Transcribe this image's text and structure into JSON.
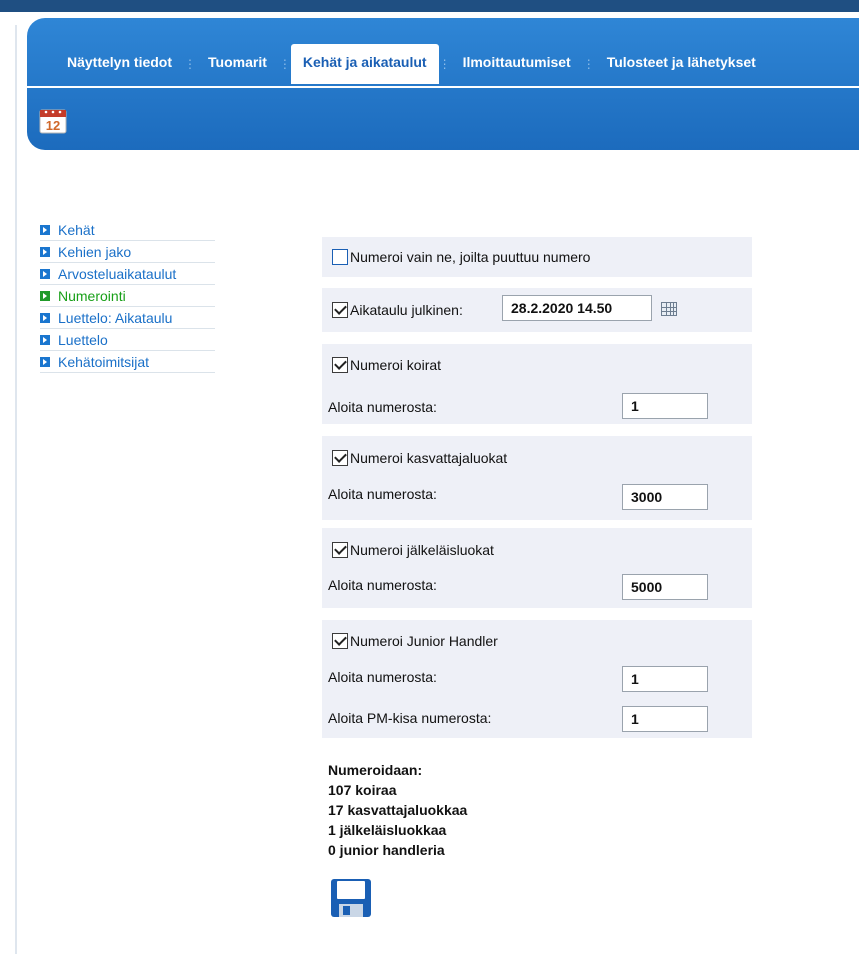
{
  "nav": {
    "tabs": [
      {
        "label": "Näyttelyn tiedot"
      },
      {
        "label": "Tuomarit"
      },
      {
        "label": "Kehät ja aikataulut"
      },
      {
        "label": "Ilmoittautumiset"
      },
      {
        "label": "Tulosteet ja lähetykset"
      }
    ],
    "calendar_icon_text": "12"
  },
  "sidebar": {
    "items": [
      {
        "label": "Kehät"
      },
      {
        "label": "Kehien jako"
      },
      {
        "label": "Arvosteluaikataulut"
      },
      {
        "label": "Numerointi"
      },
      {
        "label": "Luettelo: Aikataulu"
      },
      {
        "label": "Luettelo"
      },
      {
        "label": "Kehätoimitsijat"
      }
    ]
  },
  "form": {
    "only_missing_label": "Numeroi vain ne, joilta puuttuu numero",
    "schedule_public_label": "Aikataulu julkinen:",
    "schedule_date": "28.2.2020 14.50",
    "dogs_label": "Numeroi koirat",
    "start_from_label": "Aloita numerosta:",
    "dogs_start": "1",
    "breeder_label": "Numeroi kasvattajaluokat",
    "breeder_start": "3000",
    "progeny_label": "Numeroi jälkeläisluokat",
    "progeny_start": "5000",
    "junior_label": "Numeroi Junior Handler",
    "junior_start": "1",
    "pm_label": "Aloita PM-kisa numerosta:",
    "pm_start": "1"
  },
  "summary": {
    "title": "Numeroidaan:",
    "lines": [
      "107 koiraa",
      "17 kasvattajaluokkaa",
      "1 jälkeläisluokkaa",
      "0 junior handleria"
    ]
  }
}
